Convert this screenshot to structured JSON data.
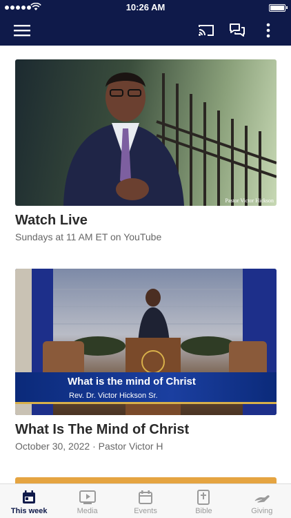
{
  "status_bar": {
    "time": "10:26 AM"
  },
  "cards": [
    {
      "title": "Watch Live",
      "subtitle": "Sundays at 11 AM ET on YouTube",
      "image_caption": "Pastor Victor Hickson"
    },
    {
      "title": "What Is The Mind of Christ",
      "subtitle": "October 30, 2022 · Pastor Victor H",
      "banner_title": "What is the mind of Christ",
      "banner_subtitle": "Rev. Dr. Victor Hickson Sr."
    }
  ],
  "tabs": [
    {
      "label": "This week",
      "icon": "calendar-icon",
      "active": true
    },
    {
      "label": "Media",
      "icon": "play-icon",
      "active": false
    },
    {
      "label": "Events",
      "icon": "calendar-outline-icon",
      "active": false
    },
    {
      "label": "Bible",
      "icon": "bible-icon",
      "active": false
    },
    {
      "label": "Giving",
      "icon": "giving-hand-icon",
      "active": false
    }
  ],
  "colors": {
    "nav": "#0f1a4a",
    "accent_peek": "#e5a441",
    "tab_inactive": "#9a9a9a"
  }
}
